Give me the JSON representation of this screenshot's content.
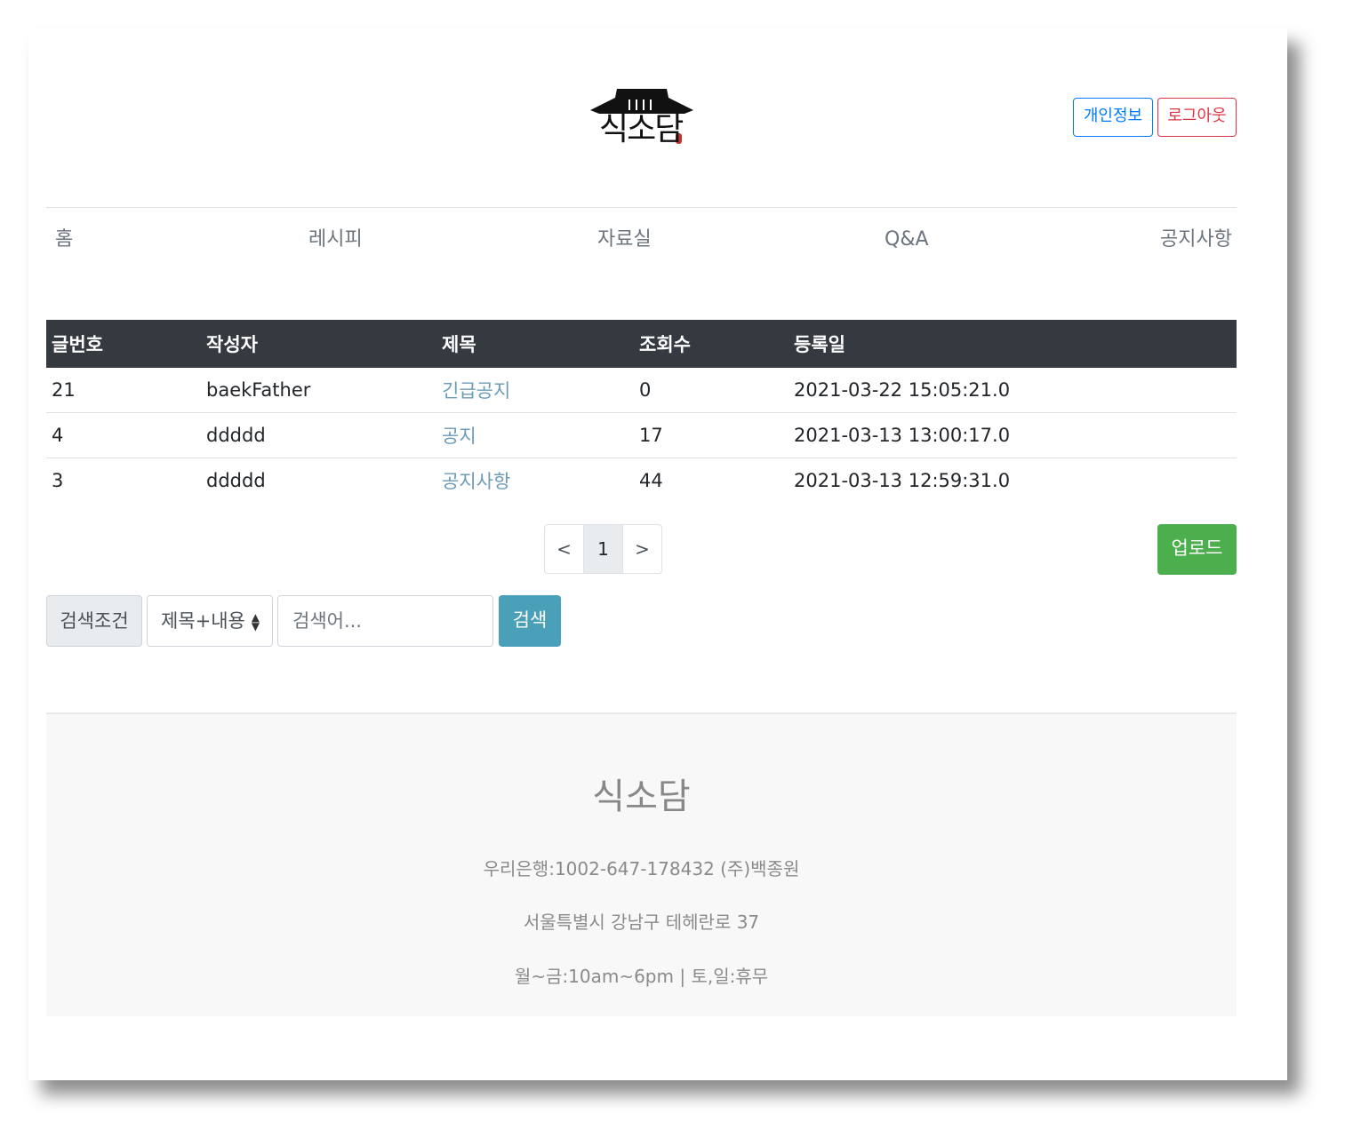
{
  "header": {
    "logo_text": "식소담",
    "btn_info": "개인정보",
    "btn_logout": "로그아웃"
  },
  "nav": {
    "items": [
      {
        "label": "홈"
      },
      {
        "label": "레시피"
      },
      {
        "label": "자료실"
      },
      {
        "label": "Q&A"
      },
      {
        "label": "공지사항"
      }
    ]
  },
  "table": {
    "headers": [
      "글번호",
      "작성자",
      "제목",
      "조회수",
      "등록일"
    ],
    "rows": [
      {
        "no": "21",
        "writer": "baekFather",
        "title": "긴급공지",
        "views": "0",
        "date": "2021-03-22 15:05:21.0"
      },
      {
        "no": "4",
        "writer": "ddddd",
        "title": "공지",
        "views": "17",
        "date": "2021-03-13 13:00:17.0"
      },
      {
        "no": "3",
        "writer": "ddddd",
        "title": "공지사항",
        "views": "44",
        "date": "2021-03-13 12:59:31.0"
      }
    ]
  },
  "pagination": {
    "prev": "<",
    "current": "1",
    "next": ">"
  },
  "upload_label": "업로드",
  "search": {
    "label": "검색조건",
    "selected": "제목+내용",
    "placeholder": "검색어...",
    "button": "검색"
  },
  "footer": {
    "brand": "식소담",
    "account": "우리은행:1002-647-178432 (주)백종원",
    "address": "서울특별시 강남구 테헤란로 37",
    "hours": "월~금:10am~6pm | 토,일:휴무"
  },
  "colors": {
    "primary": "#007bff",
    "danger": "#dc3545",
    "success": "#4cae4c",
    "info": "#4a9fb9",
    "table_header": "#343a40"
  }
}
